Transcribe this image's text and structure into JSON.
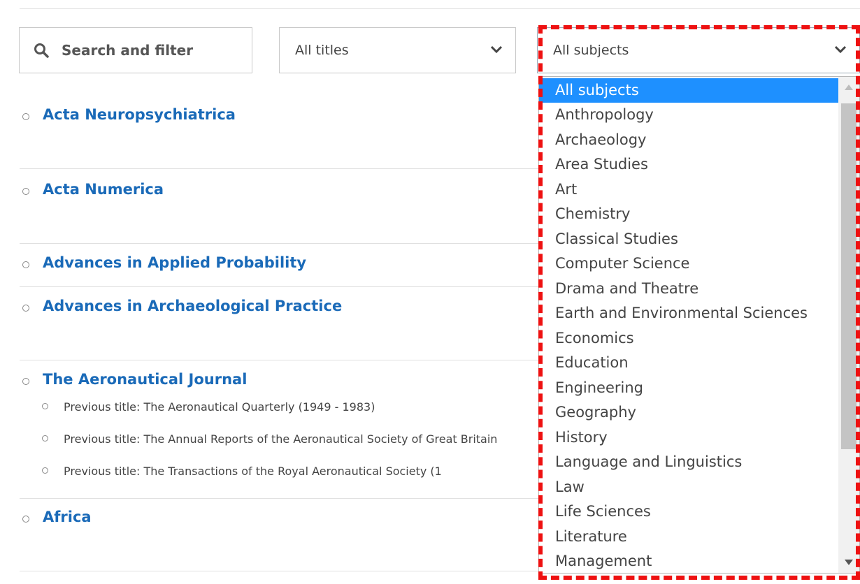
{
  "search": {
    "label": "Search and filter"
  },
  "titles_select": {
    "value": "All titles"
  },
  "subjects_select": {
    "value": "All subjects",
    "options": [
      "All subjects",
      "Anthropology",
      "Archaeology",
      "Area Studies",
      "Art",
      "Chemistry",
      "Classical Studies",
      "Computer Science",
      "Drama and Theatre",
      "Earth and Environmental Sciences",
      "Economics",
      "Education",
      "Engineering",
      "Geography",
      "History",
      "Language and Linguistics",
      "Law",
      "Life Sciences",
      "Literature",
      "Management"
    ]
  },
  "journals": [
    {
      "title": "Acta Neuropsychiatrica"
    },
    {
      "title": "Acta Numerica"
    },
    {
      "title": "Advances in Applied Probability"
    },
    {
      "title": "Advances in Archaeological Practice"
    },
    {
      "title": "The Aeronautical Journal",
      "previous_titles": [
        "Previous title: The Aeronautical Quarterly (1949 - 1983)",
        "Previous title: The Annual Reports of the Aeronautical Society of Great Britain",
        "Previous title: The Transactions of the Royal Aeronautical Society (1"
      ]
    },
    {
      "title": "Africa"
    }
  ],
  "colors": {
    "link": "#1a6ab8",
    "selected_option": "#1e90ff",
    "highlight": "#ee1111"
  }
}
